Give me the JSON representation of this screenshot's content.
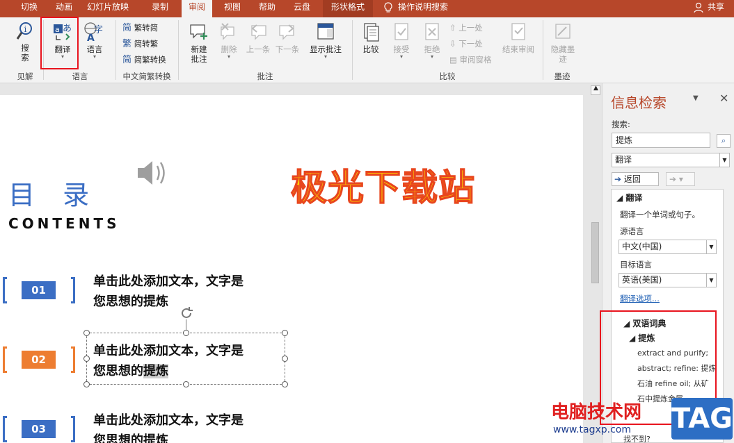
{
  "tabs": [
    "切换",
    "动画",
    "幻灯片放映",
    "录制",
    "审阅",
    "视图",
    "帮助",
    "云盘",
    "形状格式",
    "操作说明搜索"
  ],
  "share_label": "共享",
  "ribbon": {
    "search_label": "搜\n索",
    "translate_label": "翻译",
    "language_label": "语言",
    "trad_label": "繁转简",
    "simp_label": "简转繁",
    "conv_label": "简繁转换",
    "new_comment_label": "新建\n批注",
    "delete_label": "删除",
    "prev_label": "上一条",
    "next_label": "下一条",
    "show_comments_label": "显示批注",
    "compare_label": "比较",
    "accept_label": "接受",
    "reject_label": "拒绝",
    "prev_change_label": "上一处",
    "next_change_label": "下一处",
    "review_pane_label": "审阅窗格",
    "end_review_label": "结束审阅",
    "hide_ink_label": "隐藏墨\n迹",
    "groups": {
      "insights": "见解",
      "language": "语言",
      "chinese_conv": "中文简繁转换",
      "comments": "批注",
      "compare": "比较",
      "ink": "墨迹"
    }
  },
  "slide": {
    "title": "目 录",
    "subtitle": "CONTENTS",
    "watermark": "极光下载站",
    "items": [
      {
        "num": "01",
        "line1": "单击此处添加文本，文字是",
        "line2": "您思想的提炼",
        "color": "#3b6ec4"
      },
      {
        "num": "02",
        "line1": "单击此处添加文本，文字是",
        "line2a": "您思想的",
        "line2b": "提炼",
        "color": "#ed7d31"
      },
      {
        "num": "03",
        "line1": "单击此处添加文本，文字是",
        "line2": "您思想的提炼",
        "color": "#3b6ec4"
      }
    ]
  },
  "pane": {
    "title": "信息检索",
    "search_label": "搜索:",
    "search_value": "提炼",
    "service": "翻译",
    "back_label": "返回",
    "section_translate": "翻译",
    "translate_desc": "翻译一个单词或句子。",
    "source_lang_label": "源语言",
    "source_lang": "中文(中国)",
    "target_lang_label": "目标语言",
    "target_lang": "英语(美国)",
    "options_link": "翻译选项...",
    "bilingual_dict": "双语词典",
    "entry_word": "提炼",
    "def1": "extract and purify;",
    "def2": "abstract; refine: 提炼",
    "def3": "石油 refine oil; 从矿",
    "def4": "石中提炼金属",
    "bottom": "找不到?"
  },
  "watermark2": {
    "text": "电脑技术网",
    "url": "www.tagxp.com",
    "tag": "TAG"
  }
}
